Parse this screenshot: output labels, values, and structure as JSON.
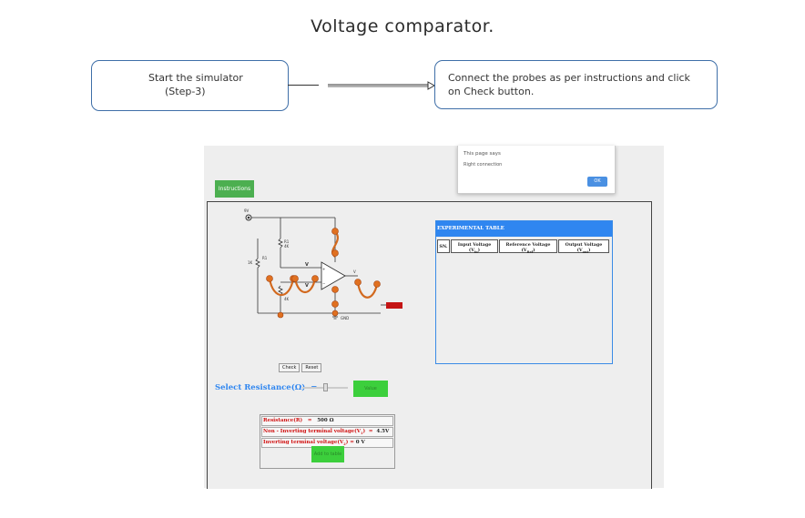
{
  "title": "Voltage comparator.",
  "steps": [
    {
      "line1": "Start the simulator",
      "line2": "(Step-3)"
    },
    {
      "line1": "Connect the probes as per instructions and click",
      "line2": "on Check button."
    }
  ],
  "dialog": {
    "title": "This page says",
    "message": "Right connection",
    "ok_label": "OK"
  },
  "simulator": {
    "instructions_label": "Instructions",
    "check_label": "Check",
    "reset_label": "Reset",
    "circuit_labels": {
      "supply": "9V",
      "r1": "R1",
      "r1_value": "4K",
      "rv": "1K",
      "pot": "R1",
      "v1": "V",
      "v2": "V",
      "vout": "V",
      "gnd": "GND",
      "r2_value": "4K"
    },
    "table": {
      "header": "EXPERIMENTAL TABLE",
      "columns": [
        {
          "label": "SN."
        },
        {
          "label": "Input Voltage",
          "sub": "(V"
        },
        {
          "label": "Reference Voltage",
          "sub": "(V"
        },
        {
          "label": "Output Voltage",
          "sub": "(V"
        }
      ]
    },
    "select_resistance_label": "Select Resistance(Ω)",
    "equals": "=",
    "slider_value": 0.5,
    "value_button": "Value",
    "readout": {
      "resistance_label": "Resistance(R)",
      "resistance_eq": "=",
      "resistance_value": "500 Ω",
      "noninv_label": "Non - Inverting terminal voltage(V",
      "noninv_sub": "1",
      "noninv_eq": "=",
      "noninv_value": "4.5V",
      "inv_label": "Inverting terminal voltage(V",
      "inv_sub": "2",
      "inv_eq": "=",
      "inv_value": "0 V",
      "add_label": "Add to table"
    }
  },
  "colors": {
    "accent": "#2f86f0",
    "green": "#3ccf3c",
    "probe": "#d2691e",
    "red_text": "#d01010"
  }
}
